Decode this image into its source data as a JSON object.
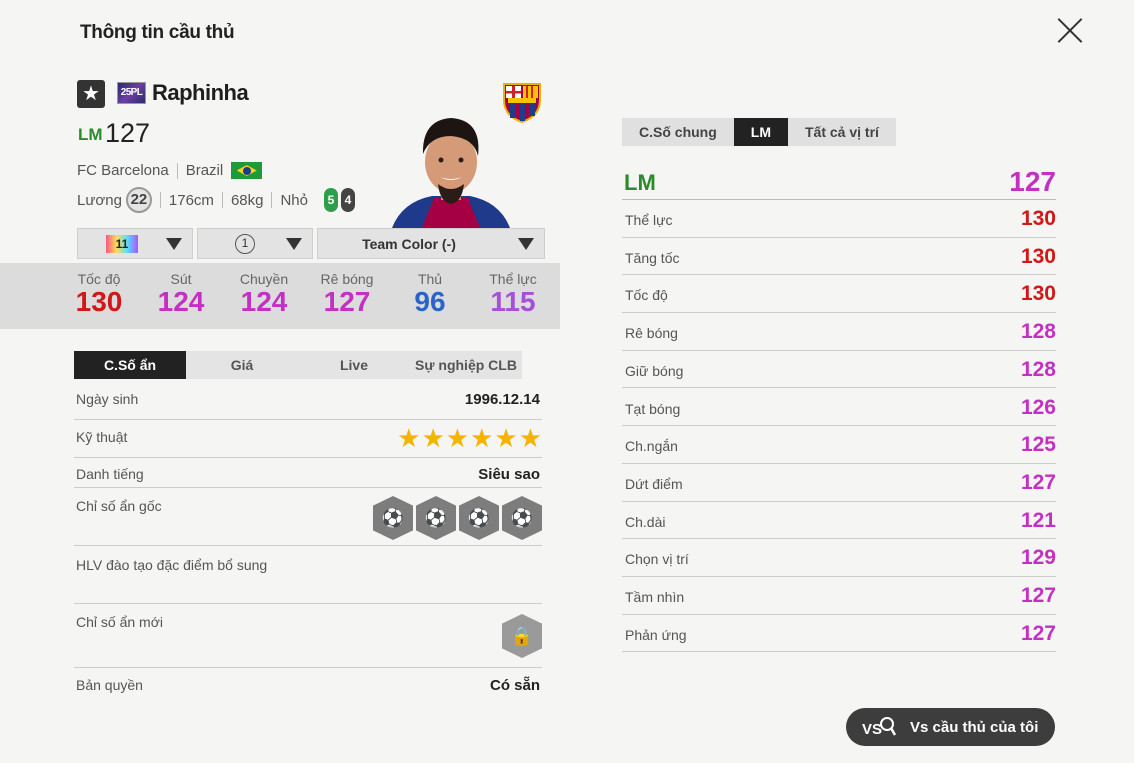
{
  "header": {
    "title": "Thông tin cầu thủ"
  },
  "player": {
    "season_badge": "25PL",
    "name": "Raphinha",
    "position": "LM",
    "ovr": "127",
    "club": "FC Barcelona",
    "nation": "Brazil",
    "salary_label": "Lương",
    "salary": "22",
    "height": "176cm",
    "weight": "68kg",
    "body_type": "Nhỏ",
    "left_foot": "5",
    "right_foot": "4"
  },
  "selectors": {
    "upgrade_level": "11",
    "team_color_count": "1",
    "team_color": "Team Color (-)"
  },
  "summary_stats": [
    {
      "label": "Tốc độ",
      "value": "130",
      "color": "#d01818"
    },
    {
      "label": "Sút",
      "value": "124",
      "color": "#c231c2"
    },
    {
      "label": "Chuyền",
      "value": "124",
      "color": "#c231c2"
    },
    {
      "label": "Rê bóng",
      "value": "127",
      "color": "#c231c2"
    },
    {
      "label": "Thủ",
      "value": "96",
      "color": "#2a64c8"
    },
    {
      "label": "Thể lực",
      "value": "115",
      "color": "#a650d8"
    }
  ],
  "tabs": [
    "C.Số ẩn",
    "Giá",
    "Live",
    "Sự nghiệp CLB"
  ],
  "info": {
    "birth_label": "Ngày sinh",
    "birth_value": "1996.12.14",
    "skill_label": "Kỹ thuật",
    "skill_stars": 6,
    "fame_label": "Danh tiếng",
    "fame_value": "Siêu sao",
    "hidden_label": "Chỉ số ẩn gốc",
    "coach_label": "HLV đào tạo đặc điểm bổ sung",
    "new_hidden_label": "Chỉ số ẩn mới",
    "license_label": "Bản quyền",
    "license_value": "Có sẵn"
  },
  "right_tabs": [
    "C.Số chung",
    "LM",
    "Tất cả vị trí"
  ],
  "position_rating": {
    "position": "LM",
    "value": "127"
  },
  "attributes": [
    {
      "label": "Thể lực",
      "value": "130",
      "color": "#d01818"
    },
    {
      "label": "Tăng tốc",
      "value": "130",
      "color": "#d01818"
    },
    {
      "label": "Tốc độ",
      "value": "130",
      "color": "#d01818"
    },
    {
      "label": "Rê bóng",
      "value": "128",
      "color": "#c231c2"
    },
    {
      "label": "Giữ bóng",
      "value": "128",
      "color": "#c231c2"
    },
    {
      "label": "Tạt bóng",
      "value": "126",
      "color": "#c231c2"
    },
    {
      "label": "Ch.ngắn",
      "value": "125",
      "color": "#c231c2"
    },
    {
      "label": "Dứt điểm",
      "value": "127",
      "color": "#c231c2"
    },
    {
      "label": "Ch.dài",
      "value": "121",
      "color": "#c231c2"
    },
    {
      "label": "Chọn vị trí",
      "value": "129",
      "color": "#c231c2"
    },
    {
      "label": "Tầm nhìn",
      "value": "127",
      "color": "#c231c2"
    },
    {
      "label": "Phản ứng",
      "value": "127",
      "color": "#c231c2"
    }
  ],
  "compare_button": {
    "label": "Vs cầu thủ của tôi"
  }
}
